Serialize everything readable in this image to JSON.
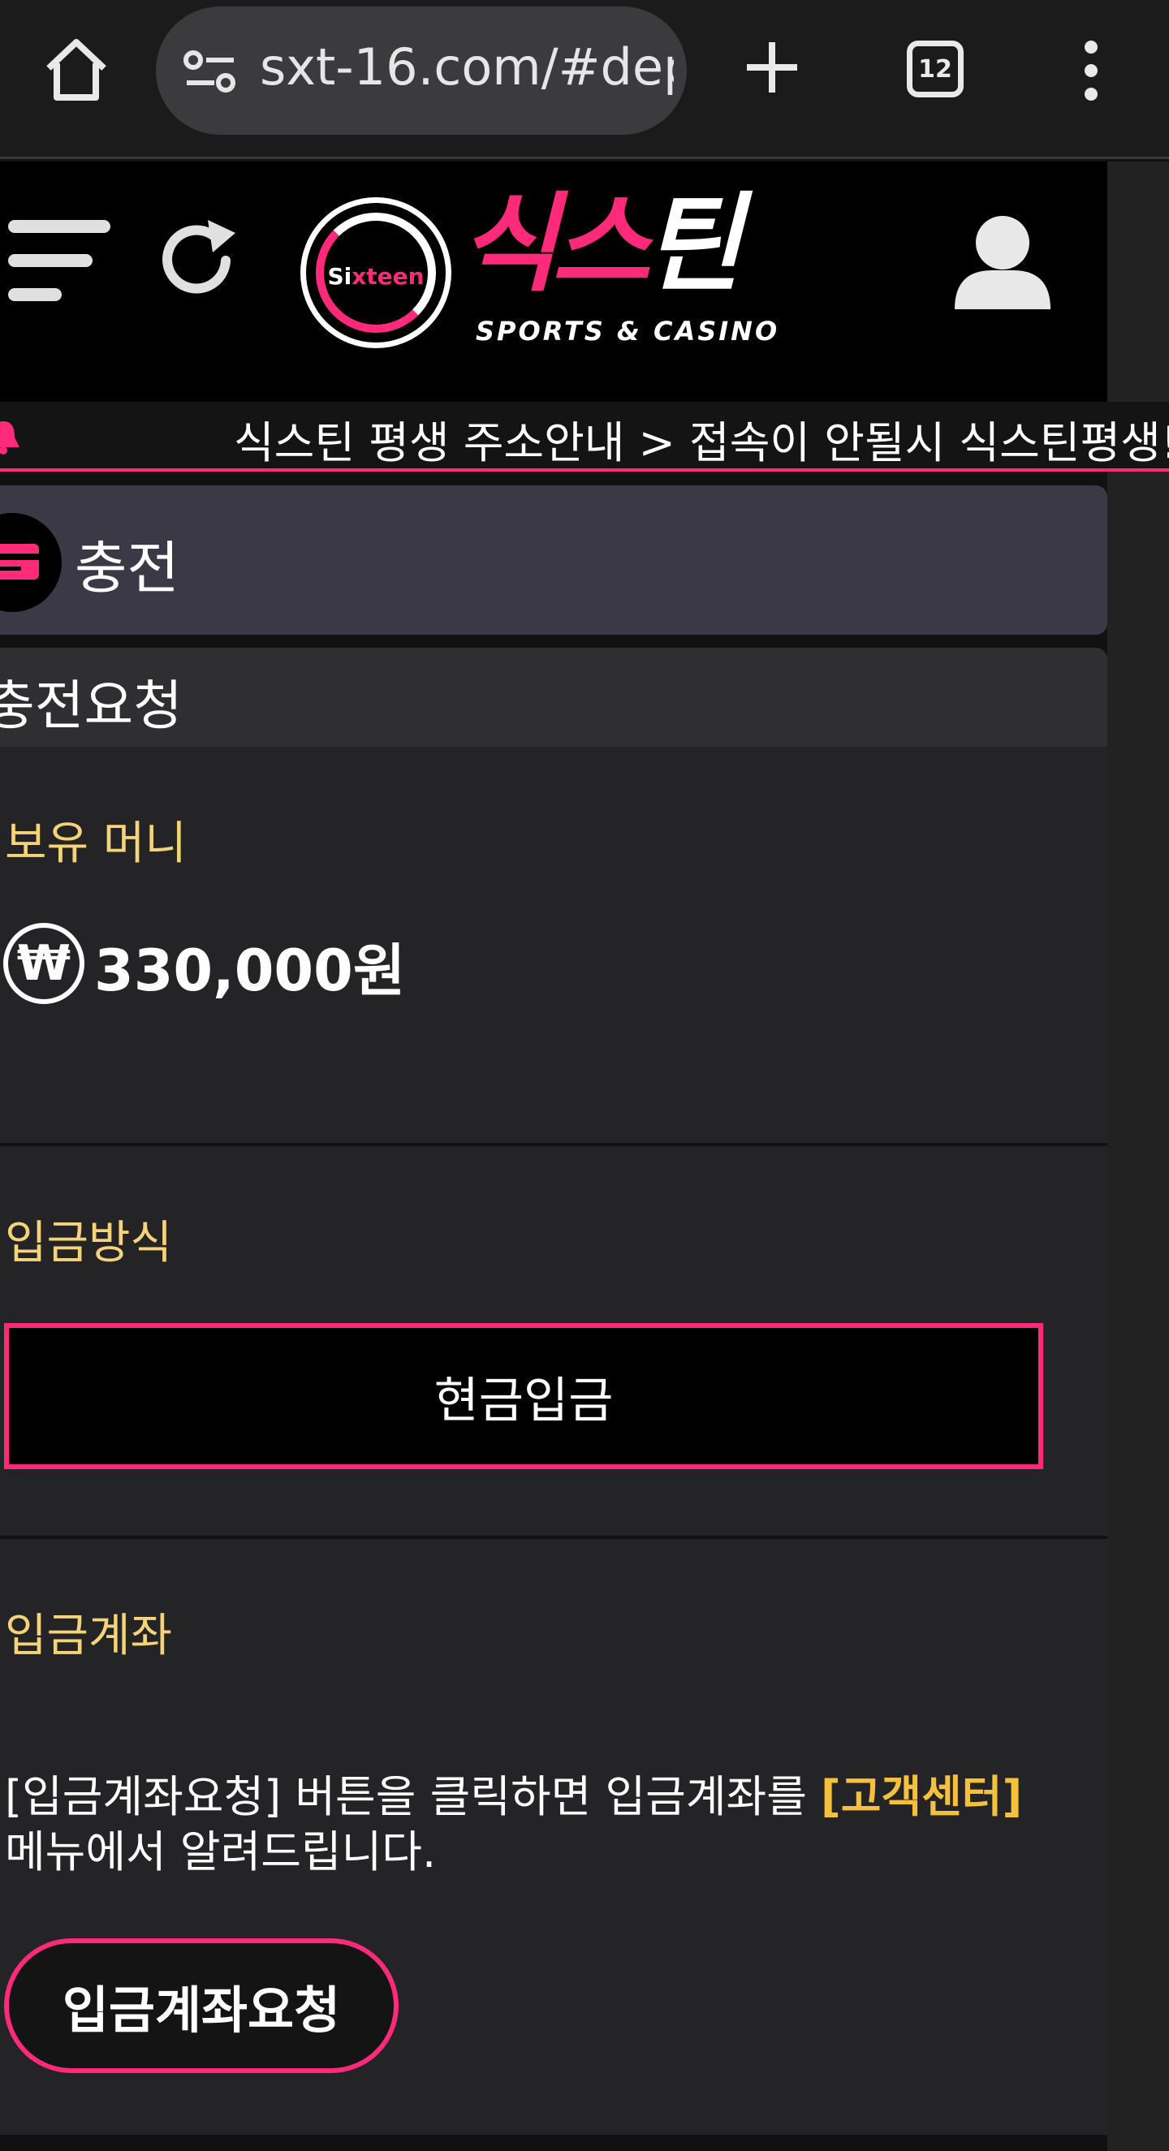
{
  "browser": {
    "url": "sxt-16.com/#dep",
    "tab_count": "12"
  },
  "site": {
    "logo_ring_text_a": "Si",
    "logo_ring_text_b": "xteen",
    "logo_word_a": "식스",
    "logo_word_b": "틴",
    "logo_sub": "SPORTS & CASINO",
    "marquee": "식스틴 평생 주소안내 > 접속이 안될시 식스틴평생!",
    "accent_color": "#ff2a7a",
    "label_color": "#f5d37a"
  },
  "section": {
    "title": "충전"
  },
  "panel": {
    "header": "충전요청",
    "balance_label": "보유 머니",
    "currency_symbol": "₩",
    "balance_value": "330,000원",
    "method_label": "입금방식",
    "method_value": "현금입금",
    "account_label": "입금계좌",
    "notice_part1": "[입금계좌요청] 버튼을 클릭하면 입금계좌를 ",
    "notice_highlight": "[고객센터]",
    "notice_part2": "메뉴에서 알려드립니다.",
    "request_button": "입금계좌요청"
  }
}
